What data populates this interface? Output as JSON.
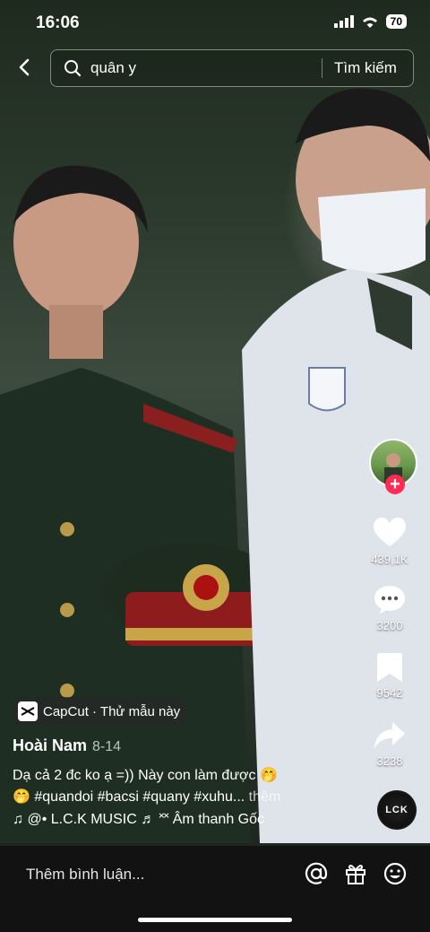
{
  "status": {
    "time": "16:06",
    "battery": "70"
  },
  "search": {
    "query": "quân y",
    "submit_label": "Tìm kiếm"
  },
  "actions": {
    "likes": "439,1K",
    "comments": "3200",
    "saves": "9542",
    "shares": "3238"
  },
  "capcut": {
    "label": "CapCut · Thử mẫu này"
  },
  "post": {
    "author": "Hoài Nam",
    "date": "8-14",
    "caption_line1": "Dạ cả 2 đc ko ạ =))  Này con làm được 🤭",
    "caption_line2": "🤭 #quandoi #bacsi #quany #xuhu...",
    "more": " thêm",
    "sound": "♫ @• L.C.K  MUSIC ♬ ˟˟ Âm thanh Gốc"
  },
  "disc_text": "LCK",
  "comment": {
    "placeholder": "Thêm bình luận..."
  },
  "colors": {
    "accent": "#fe2c55",
    "bottom_bar": "#121212"
  }
}
